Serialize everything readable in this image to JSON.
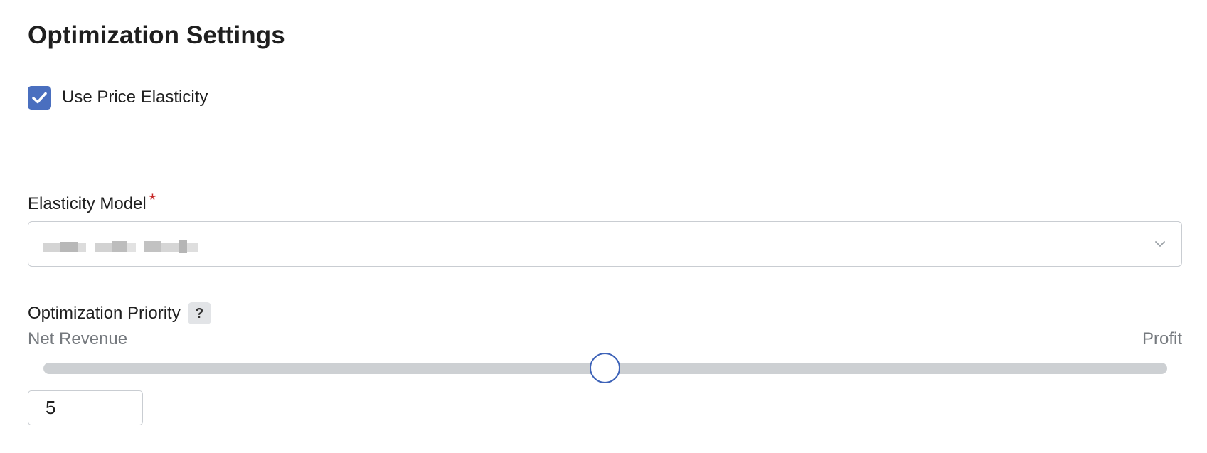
{
  "page": {
    "title": "Optimization Settings"
  },
  "use_price_elasticity": {
    "label": "Use Price Elasticity",
    "checked": true
  },
  "elasticity_model": {
    "label": "Elasticity Model",
    "required_marker": "*",
    "selected_value": "",
    "icon": "chevron-down-icon"
  },
  "optimization_priority": {
    "label": "Optimization Priority",
    "help_text": "?",
    "min_label": "Net Revenue",
    "max_label": "Profit",
    "value": "5",
    "slider_fraction": 0.5
  },
  "colors": {
    "accent": "#4a6fbf",
    "required": "#c62828",
    "track": "#cdd0d3"
  }
}
